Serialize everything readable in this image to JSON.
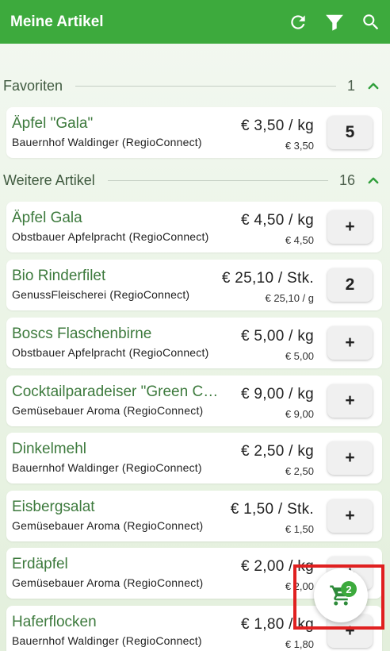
{
  "appbar": {
    "title": "Meine Artikel",
    "icons": [
      "refresh-icon",
      "filter-icon",
      "search-icon"
    ]
  },
  "sections": [
    {
      "title": "Favoriten",
      "count": "1",
      "items": [
        {
          "name": "Äpfel \"Gala\"",
          "producer": "Bauernhof Waldinger (RegioConnect)",
          "price": "€ 3,50 / kg",
          "subprice": "€ 3,50",
          "button": "5"
        }
      ]
    },
    {
      "title": "Weitere Artikel",
      "count": "16",
      "items": [
        {
          "name": "Äpfel Gala",
          "producer": "Obstbauer Apfelpracht (RegioConnect)",
          "price": "€ 4,50 / kg",
          "subprice": "€ 4,50",
          "button": "+"
        },
        {
          "name": "Bio Rinderfilet",
          "producer": "GenussFleischerei (RegioConnect)",
          "price": "€ 25,10 / Stk.",
          "subprice": "€ 25,10 / g",
          "button": "2"
        },
        {
          "name": "Boscs Flaschenbirne",
          "producer": "Obstbauer Apfelpracht (RegioConnect)",
          "price": "€ 5,00 / kg",
          "subprice": "€ 5,00",
          "button": "+"
        },
        {
          "name": "Cocktailparadeiser \"Green Cherry\"",
          "producer": "Gemüsebauer Aroma (RegioConnect)",
          "price": "€ 9,00 / kg",
          "subprice": "€ 9,00",
          "button": "+"
        },
        {
          "name": "Dinkelmehl",
          "producer": "Bauernhof Waldinger (RegioConnect)",
          "price": "€ 2,50 / kg",
          "subprice": "€ 2,50",
          "button": "+"
        },
        {
          "name": "Eisbergsalat",
          "producer": "Gemüsebauer Aroma (RegioConnect)",
          "price": "€ 1,50 / Stk.",
          "subprice": "€ 1,50",
          "button": "+"
        },
        {
          "name": "Erdäpfel",
          "producer": "Gemüsebauer Aroma (RegioConnect)",
          "price": "€ 2,00 / kg",
          "subprice": "€ 2,00",
          "button": "+"
        },
        {
          "name": "Haferflocken",
          "producer": "Bauernhof Waldinger (RegioConnect)",
          "price": "€ 1,80 / kg",
          "subprice": "€ 1,80",
          "button": "+"
        }
      ]
    }
  ],
  "cart": {
    "count": "2",
    "icon": "cart-icon"
  },
  "colors": {
    "primary": "#3daa3d",
    "name_text": "#3d7a3d",
    "highlight": "#e02020"
  }
}
